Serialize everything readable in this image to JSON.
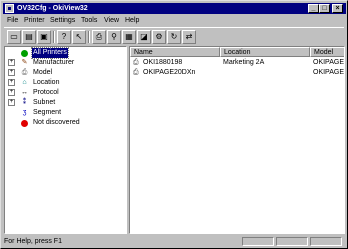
{
  "window": {
    "title": "OV32Cfg - OkiView32"
  },
  "menu": [
    "File",
    "Printer",
    "Settings",
    "Tools",
    "View",
    "Help"
  ],
  "toolbar": {
    "buttons": [
      "new-icon",
      "open-icon",
      "save-icon",
      "help-icon",
      "context-help-icon",
      "printer-settings-icon",
      "discover-icon",
      "properties-icon",
      "status-icon",
      "network-icon",
      "refresh-icon",
      "connect-icon"
    ]
  },
  "tree": {
    "items": [
      {
        "label": "All Printers",
        "icon": "green-dot-icon",
        "color": "#00a000",
        "selected": true
      },
      {
        "label": "Manufacturer",
        "icon": "manufacturer-icon",
        "expandable": true
      },
      {
        "label": "Model",
        "icon": "model-icon",
        "expandable": true
      },
      {
        "label": "Location",
        "icon": "location-icon",
        "expandable": true
      },
      {
        "label": "Protocol",
        "icon": "protocol-icon",
        "expandable": true
      },
      {
        "label": "Subnet",
        "icon": "subnet-icon",
        "expandable": true
      },
      {
        "label": "Segment",
        "icon": "segment-icon"
      },
      {
        "label": "Not discovered",
        "icon": "red-dot-icon",
        "color": "#e00000"
      }
    ]
  },
  "list": {
    "columns": [
      "Name",
      "Location",
      "Model"
    ],
    "rows": [
      {
        "name": "OKI1880198",
        "location": "Marketing 2A",
        "model": "OKIPAGE"
      },
      {
        "name": "OKIPAGE20DXn",
        "location": "",
        "model": "OKIPAGE"
      }
    ]
  },
  "status": {
    "text": "For Help, press F1"
  }
}
